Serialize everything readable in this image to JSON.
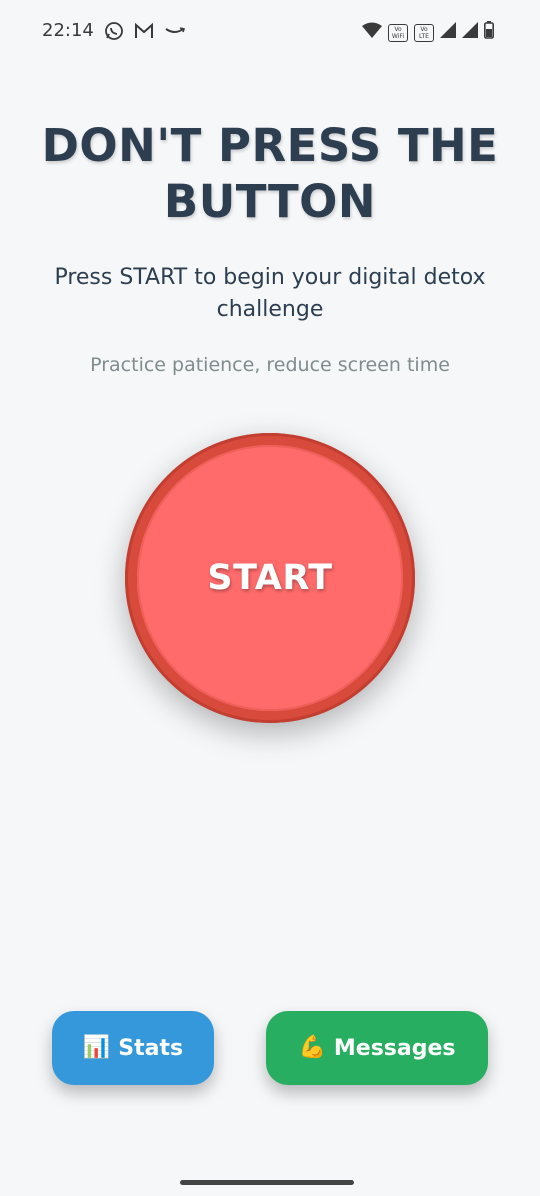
{
  "status_bar": {
    "time": "22:14",
    "left_icons": [
      "whatsapp-icon",
      "gmail-icon",
      "amazon-icon"
    ],
    "right_icons": [
      "wifi-icon",
      "vowifi-badge",
      "volte-badge",
      "signal-icon",
      "signal-icon-2",
      "battery-icon"
    ],
    "vowifi_text": "Vo 2\nWiFi",
    "volte_text": "Vo 1\nLTE"
  },
  "header": {
    "title_line1": "DON'T PRESS THE",
    "title_line2": "BUTTON",
    "subtitle": "Press START to begin your digital detox challenge",
    "tagline": "Practice patience, reduce screen time"
  },
  "main": {
    "start_label": "START"
  },
  "footer": {
    "stats_icon": "📊",
    "stats_label": "Stats",
    "messages_icon": "💪",
    "messages_label": "Messages"
  },
  "colors": {
    "background": "#f6f7f9",
    "title": "#2c3e50",
    "start_outer": "#d84a3c",
    "start_inner": "#ff6b6b",
    "stats_button": "#3498db",
    "messages_button": "#27ae60"
  }
}
